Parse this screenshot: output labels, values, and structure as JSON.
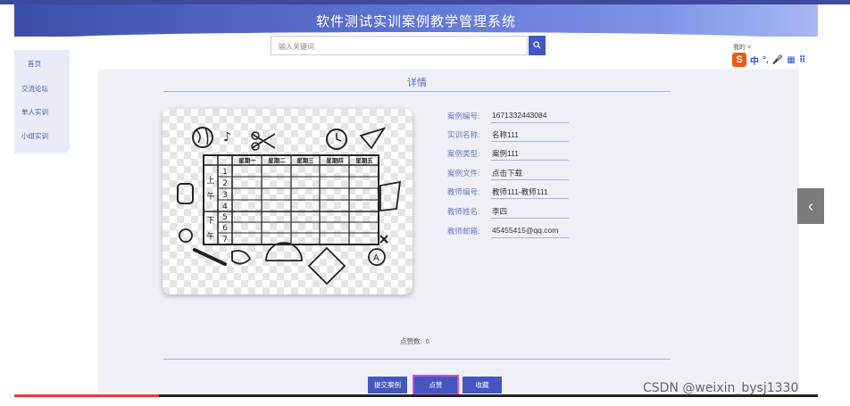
{
  "header": {
    "title": "软件测试实训案例教学管理系统"
  },
  "search": {
    "placeholder": "输入关键词",
    "button_icon": "search-icon"
  },
  "user": {
    "label": "我的 ˅"
  },
  "ime": {
    "logo": "S",
    "items": [
      "中",
      "°,",
      "🎤",
      "▦",
      "⠿"
    ]
  },
  "sidebar": {
    "items": [
      {
        "label": "首页"
      },
      {
        "label": "交流论坛"
      },
      {
        "label": "单人实训"
      },
      {
        "label": "小组实训"
      }
    ]
  },
  "detail": {
    "title": "详情",
    "image": {
      "day_headers": [
        "星期一",
        "星期二",
        "星期三",
        "星期四",
        "星期五"
      ],
      "period_numbers": [
        "1",
        "2",
        "3",
        "4",
        "5",
        "6",
        "7"
      ],
      "morning_label": [
        "上",
        "午"
      ],
      "afternoon_label": [
        "下",
        "午"
      ]
    },
    "fields": [
      {
        "label": "案例编号:",
        "value": "1671332443084"
      },
      {
        "label": "实训名称:",
        "value": "名称111"
      },
      {
        "label": "案例类型:",
        "value": "案例111"
      },
      {
        "label": "案例文件:",
        "value": "点击下载"
      },
      {
        "label": "教师编号:",
        "value": "教师111-教师111"
      },
      {
        "label": "教师姓名:",
        "value": "李四"
      },
      {
        "label": "教师邮箱:",
        "value": "45455415@qq.com"
      }
    ],
    "likes_label": "点赞数:",
    "likes_value": "0"
  },
  "actions": {
    "submit": "提交案例",
    "like": "点赞",
    "favorite": "收藏"
  },
  "carousel": {
    "prev_icon": "‹"
  },
  "watermark": "CSDN @weixin_bysj1330",
  "colors": {
    "primary": "#4456c0",
    "header_gradient_start": "#3b4fa8",
    "label": "#6a78c4"
  }
}
